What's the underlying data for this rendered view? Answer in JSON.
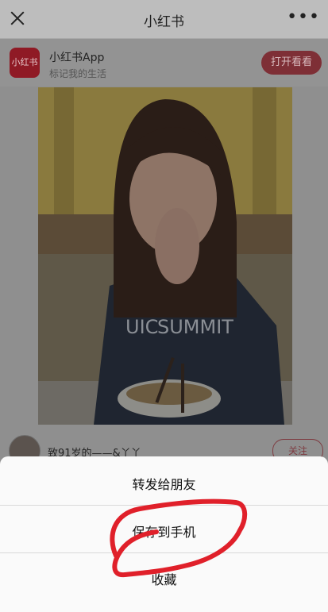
{
  "header": {
    "title": "小红书",
    "close_icon": "close-icon",
    "more_icon": "more-icon",
    "more_glyph": "•••"
  },
  "app_banner": {
    "logo_text": "小红书",
    "app_name": "小红书App",
    "slogan": "标记我的生活",
    "open_label": "打开看看"
  },
  "author": {
    "name": "致91岁的——&丫丫",
    "follow_label": "关注"
  },
  "share_sheet": {
    "items": [
      {
        "label": "转发给朋友"
      },
      {
        "label": "保存到手机"
      },
      {
        "label": "收藏"
      }
    ]
  },
  "colors": {
    "brand_red": "#ff2442",
    "annotation_red": "#e0202a",
    "overlay_dim": "rgba(0,0,0,0.45)"
  }
}
